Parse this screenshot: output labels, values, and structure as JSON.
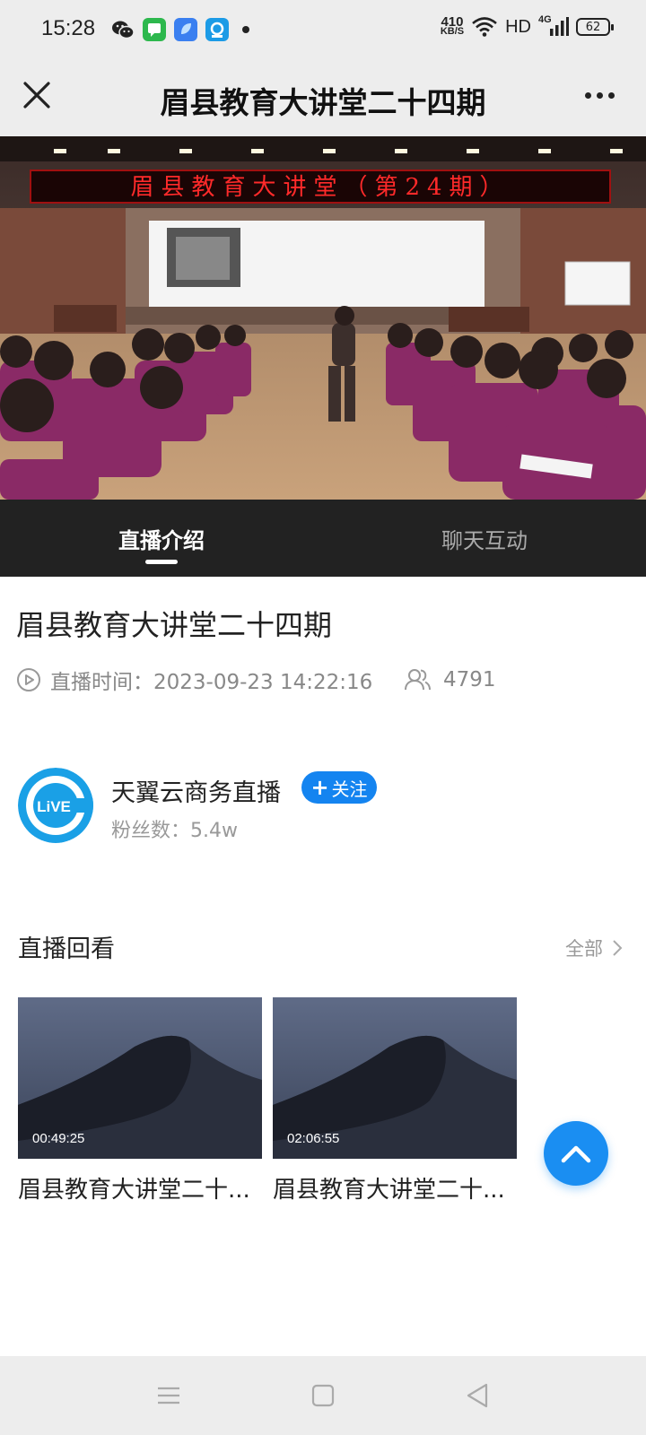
{
  "status_bar": {
    "time": "15:28",
    "net_speed_value": "410",
    "net_speed_unit": "KB/S",
    "hd_label": "HD",
    "network_label": "4G",
    "battery_level": "62"
  },
  "nav": {
    "title": "眉县教育大讲堂二十四期"
  },
  "video": {
    "banner_text": "眉县教育大讲堂（第24期）"
  },
  "tabs": [
    {
      "label": "直播介绍",
      "active": true
    },
    {
      "label": "聊天互动",
      "active": false
    }
  ],
  "live": {
    "title": "眉县教育大讲堂二十四期",
    "time": "直播时间：2023-09-23 14:22:16",
    "viewers": "4791"
  },
  "host": {
    "name": "天翼云商务直播",
    "follow_label": "关注",
    "fans": "粉丝数：5.4w",
    "avatar_text": "LiVE"
  },
  "replay": {
    "section_title": "直播回看",
    "all_label": "全部",
    "items": [
      {
        "title": "眉县教育大讲堂二十...",
        "duration": "00:49:25"
      },
      {
        "title": "眉县教育大讲堂二十...",
        "duration": "02:06:55"
      }
    ]
  },
  "colors": {
    "accent": "#1484f0",
    "tab_bg": "#222222",
    "fab": "#1a8ef2"
  }
}
